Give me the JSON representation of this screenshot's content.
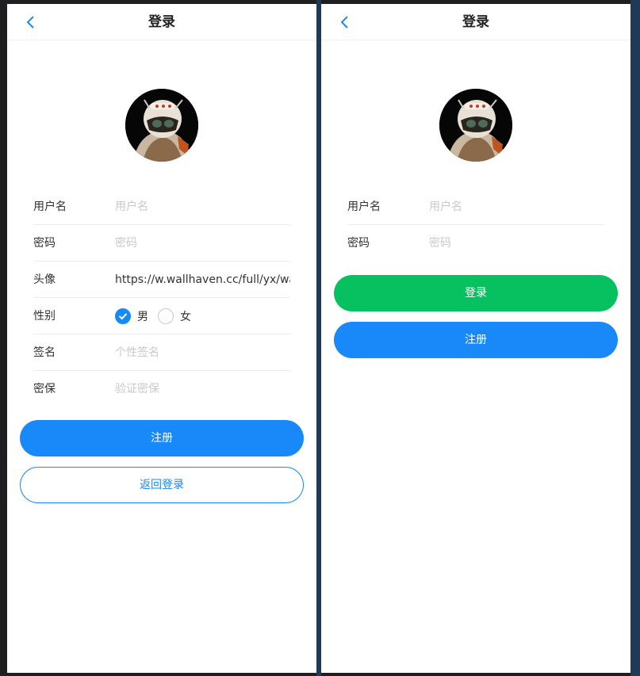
{
  "colors": {
    "primary": "#1989fa",
    "success": "#07c160",
    "frame": "#1f3a58"
  },
  "register_page": {
    "nav_title": "登录",
    "back_icon": "chevron-left-icon",
    "avatar_icon": "astronaut-avatar",
    "form": {
      "username_label": "用户名",
      "username_placeholder": "用户名",
      "password_label": "密码",
      "password_placeholder": "密码",
      "avatar_label": "头像",
      "avatar_value": "https://w.wallhaven.cc/full/yx/wallhaven-yxzmwl.jpg",
      "gender_label": "性别",
      "gender_male": "男",
      "gender_female": "女",
      "gender_selected": "男",
      "signature_label": "签名",
      "signature_placeholder": "个性签名",
      "security_label": "密保",
      "security_placeholder": "验证密保"
    },
    "register_button": "注册",
    "back_to_login_button": "返回登录"
  },
  "login_page": {
    "nav_title": "登录",
    "back_icon": "chevron-left-icon",
    "avatar_icon": "astronaut-avatar",
    "form": {
      "username_label": "用户名",
      "username_placeholder": "用户名",
      "password_label": "密码",
      "password_placeholder": "密码"
    },
    "login_button": "登录",
    "register_button": "注册"
  }
}
